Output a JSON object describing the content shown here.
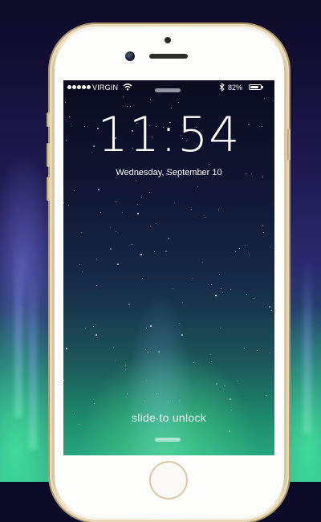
{
  "status_bar": {
    "signal_dots": 5,
    "carrier": "VIRGIN",
    "wifi_icon": "wifi-icon",
    "bluetooth_icon": "bluetooth-icon",
    "battery_percent_text": "82%",
    "battery_level": 0.82
  },
  "lock_screen": {
    "time": "11:54",
    "date": "Wednesday, September 10",
    "slide_prompt": "slide to unlock"
  },
  "colors": {
    "text": "#ffffff",
    "aurora_green": "#2aa97f",
    "sky_dark": "#0d0a26",
    "phone_gold": "#c8b48c"
  }
}
